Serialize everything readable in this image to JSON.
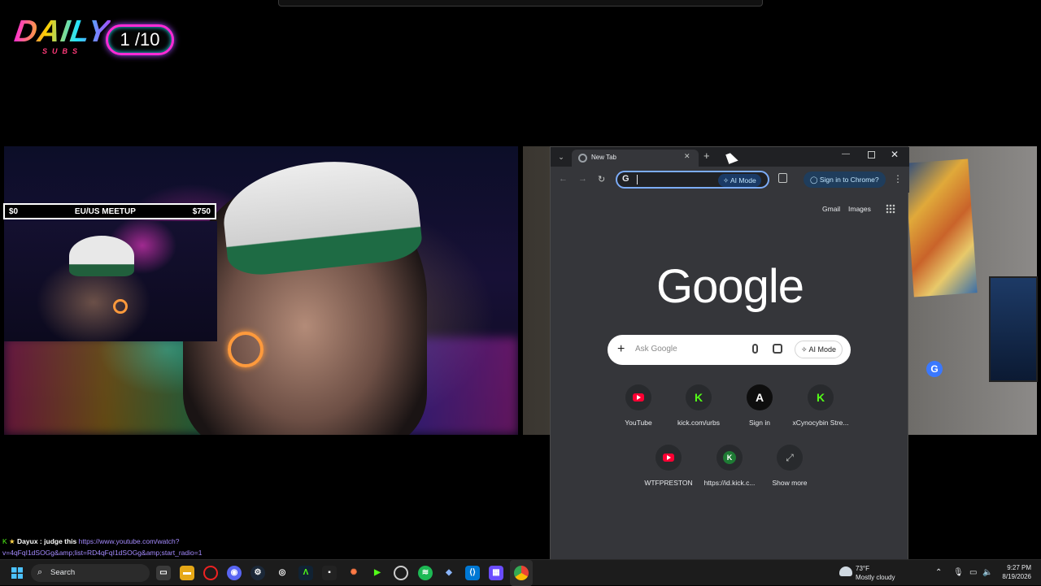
{
  "overlay": {
    "logo_text": "DAILY",
    "logo_sub": "SUBS",
    "sub_counter": "1 /10",
    "goal": {
      "left": "$0",
      "title": "EU/US MEETUP",
      "right": "$750"
    }
  },
  "chrome": {
    "tab_title": "New Tab",
    "new_tab_glyph": "+",
    "omnibox": {
      "g_glyph": "G",
      "ai_mode_label": "AI Mode"
    },
    "signin_label": "Sign in to Chrome?",
    "links": {
      "gmail": "Gmail",
      "images": "Images"
    },
    "logo": "Google",
    "search": {
      "placeholder": "Ask Google",
      "ai_mode_label": "AI Mode"
    },
    "shortcuts": [
      {
        "label": "YouTube",
        "icon": "youtube-icon"
      },
      {
        "label": "kick.com/urbs",
        "icon": "kick-icon"
      },
      {
        "label": "Sign in",
        "icon": "a-icon"
      },
      {
        "label": "xCynocybin Stre...",
        "icon": "kick-icon"
      },
      {
        "label": "WTFPRESTON",
        "icon": "youtube-icon"
      },
      {
        "label": "https://id.kick.c...",
        "icon": "k-circle-icon"
      },
      {
        "label": "Show more",
        "icon": "expand-icon"
      }
    ]
  },
  "chat": {
    "badge": "K",
    "star": "★",
    "user": "Dayux :",
    "message": "judge this",
    "link_part1": "https://www.youtube.com/watch?",
    "link_part2": "v=4qFqI1dSOGg&amp;list=RD4qFqI1dSOGg&amp;start_radio=1"
  },
  "taskbar": {
    "search_label": "Search",
    "weather_temp": "73°F",
    "weather_desc": "Mostly cloudy",
    "time": "9:27 PM",
    "date": "8/19/2026"
  },
  "colors": {
    "accent": "#7cacf8",
    "kick_green": "#53fc18",
    "youtube_red": "#ff0033"
  }
}
